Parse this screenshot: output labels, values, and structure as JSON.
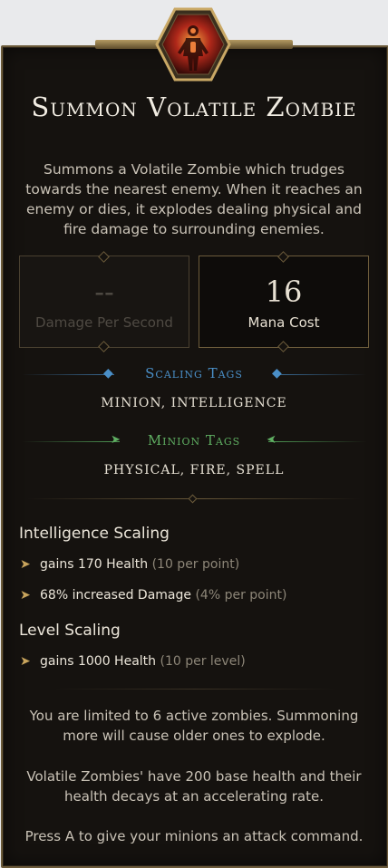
{
  "skill": {
    "title": "Summon Volatile Zombie",
    "description": "Summons a Volatile Zombie which trudges towards the nearest enemy. When it reaches an enemy or dies, it explodes dealing physical and fire damage to surrounding enemies."
  },
  "stats": {
    "dps_value": "--",
    "dps_label": "Damage Per Second",
    "mana_value": "16",
    "mana_label": "Mana Cost"
  },
  "scaling_tags": {
    "title": "Scaling Tags",
    "values": "MINION, INTELLIGENCE",
    "color": "#4a8fc8"
  },
  "minion_tags": {
    "title": "Minion Tags",
    "values": "PHYSICAL, FIRE, SPELL",
    "color": "#5fae62"
  },
  "intelligence_scaling": {
    "heading": "Intelligence Scaling",
    "items": [
      {
        "main": "gains 170 Health",
        "sub": "(10 per point)"
      },
      {
        "main": "68% increased Damage",
        "sub": "(4% per point)"
      }
    ]
  },
  "level_scaling": {
    "heading": "Level Scaling",
    "items": [
      {
        "main": "gains 1000 Health",
        "sub": "(10 per level)"
      }
    ]
  },
  "notes": [
    "You are limited to 6 active zombies. Summoning more will cause older ones to explode.",
    "Volatile Zombies' have 200 base health and their health decays at an accelerating rate.",
    "Press A to give your minions an attack command."
  ],
  "icons": {
    "badge": "volatile-zombie-icon",
    "bullet": "arrow-bullet-icon"
  }
}
